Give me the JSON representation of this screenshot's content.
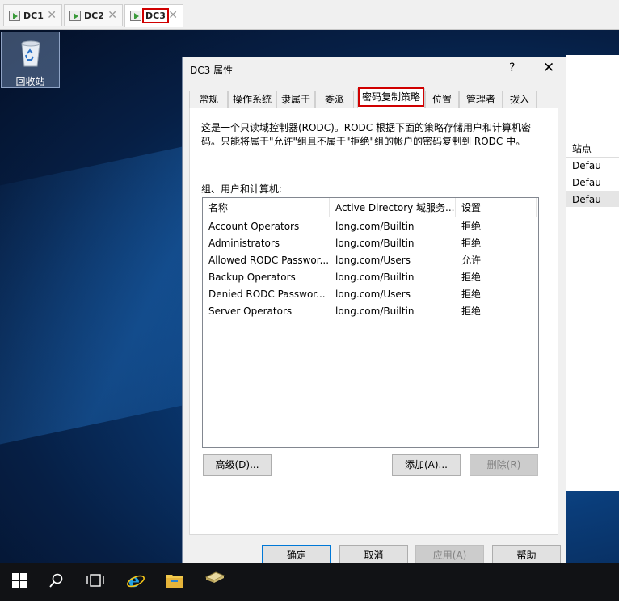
{
  "vm_tabs": [
    {
      "label": "DC1",
      "active": false
    },
    {
      "label": "DC2",
      "active": false
    },
    {
      "label": "DC3",
      "active": true
    }
  ],
  "desktop": {
    "recycle_bin_label": "回收站"
  },
  "background_window": {
    "column_header": "站点",
    "rows": [
      "Defau",
      "Defau",
      "Defau"
    ]
  },
  "dialog": {
    "title": "DC3 属性",
    "help_label": "?",
    "close_label": "✕",
    "tabs": [
      {
        "label": "常规"
      },
      {
        "label": "操作系统"
      },
      {
        "label": "隶属于"
      },
      {
        "label": "委派"
      },
      {
        "label": "密码复制策略",
        "active": true
      },
      {
        "label": "位置"
      },
      {
        "label": "管理者"
      },
      {
        "label": "拨入"
      }
    ],
    "description": "这是一个只读域控制器(RODC)。RODC 根据下面的策略存储用户和计算机密码。只能将属于\"允许\"组且不属于\"拒绝\"组的帐户的密码复制到 RODC 中。",
    "list_label": "组、用户和计算机:",
    "columns": [
      "名称",
      "Active Directory 域服务...",
      "设置"
    ],
    "rows": [
      {
        "name": "Account Operators",
        "location": "long.com/Builtin",
        "setting": "拒绝"
      },
      {
        "name": "Administrators",
        "location": "long.com/Builtin",
        "setting": "拒绝"
      },
      {
        "name": "Allowed RODC Passwor...",
        "location": "long.com/Users",
        "setting": "允许"
      },
      {
        "name": "Backup Operators",
        "location": "long.com/Builtin",
        "setting": "拒绝"
      },
      {
        "name": "Denied RODC Passwor...",
        "location": "long.com/Users",
        "setting": "拒绝"
      },
      {
        "name": "Server Operators",
        "location": "long.com/Builtin",
        "setting": "拒绝"
      }
    ],
    "buttons": {
      "advanced": "高级(D)...",
      "add": "添加(A)...",
      "remove": "删除(R)",
      "ok": "确定",
      "cancel": "取消",
      "apply": "应用(A)",
      "help": "帮助"
    }
  },
  "taskbar": {
    "icons": [
      "windows-start-icon",
      "search-icon",
      "task-view-icon",
      "internet-explorer-icon",
      "file-explorer-icon",
      "server-manager-icon"
    ]
  },
  "colors": {
    "desktop_blue": "#0a3d7a",
    "highlight_red": "#d00000",
    "taskbar": "#111215",
    "default_button_border": "#0078d7"
  }
}
